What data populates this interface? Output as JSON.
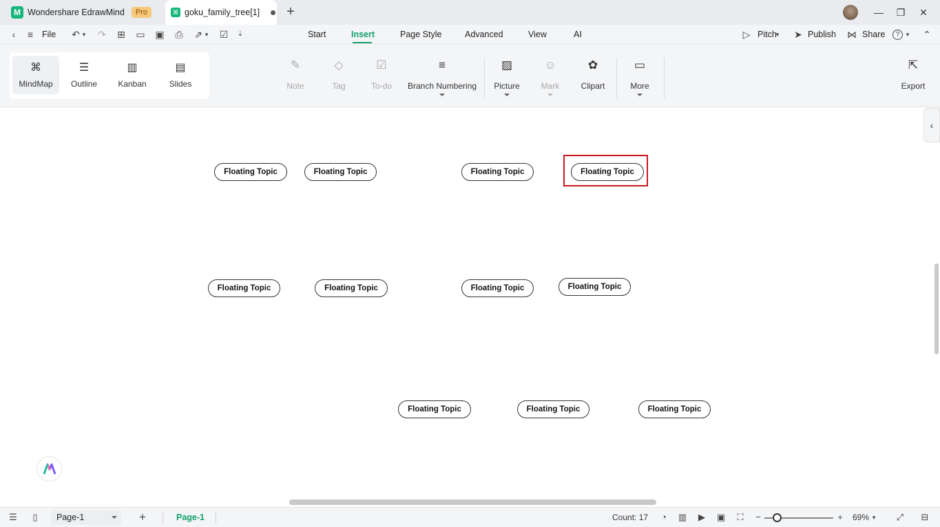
{
  "titlebar": {
    "app_tab": {
      "logo_text": "M",
      "title": "Wondershare EdrawMind",
      "badge": "Pro"
    },
    "doc_tab": {
      "title": "goku_family_tree[1]"
    },
    "new_tab": "+",
    "window_controls": {
      "minimize": "—",
      "maximize": "❐",
      "close": "✕"
    }
  },
  "menubar": {
    "file_label": "File",
    "tabs": [
      {
        "label": "Start"
      },
      {
        "label": "Insert",
        "active": true
      },
      {
        "label": "Page Style"
      },
      {
        "label": "Advanced"
      },
      {
        "label": "View"
      },
      {
        "label": "AI"
      }
    ],
    "pitch_label": "Pitch",
    "publish_label": "Publish",
    "share_label": "Share",
    "help_label": "?"
  },
  "views": [
    {
      "label": "MindMap",
      "icon": "mindmap-icon",
      "glyph": "⌘",
      "active": true
    },
    {
      "label": "Outline",
      "icon": "outline-icon",
      "glyph": "☰"
    },
    {
      "label": "Kanban",
      "icon": "kanban-icon",
      "glyph": "▥"
    },
    {
      "label": "Slides",
      "icon": "slides-icon",
      "glyph": "▤"
    }
  ],
  "tools": [
    {
      "label": "Note",
      "icon": "note-icon",
      "glyph": "✎",
      "enabled": false
    },
    {
      "label": "Tag",
      "icon": "tag-icon",
      "glyph": "◇",
      "enabled": false
    },
    {
      "label": "To-do",
      "icon": "todo-icon",
      "glyph": "☑",
      "enabled": false
    },
    {
      "label": "Branch Numbering",
      "icon": "branch-numbering-icon",
      "glyph": "≡",
      "enabled": true,
      "dropdown": true
    },
    {
      "label": "Picture",
      "icon": "picture-icon",
      "glyph": "▨",
      "enabled": true,
      "dropdown": true
    },
    {
      "label": "Mark",
      "icon": "mark-icon",
      "glyph": "☺",
      "enabled": false,
      "dropdown": true
    },
    {
      "label": "Clipart",
      "icon": "clipart-icon",
      "glyph": "✿",
      "enabled": true
    },
    {
      "label": "More",
      "icon": "more-icon",
      "glyph": "▭",
      "enabled": true,
      "dropdown": true
    },
    {
      "label": "Export",
      "icon": "export-icon",
      "glyph": "⇱",
      "enabled": true
    }
  ],
  "canvas": {
    "topics": [
      "Floating Topic",
      "Floating Topic",
      "Floating Topic",
      "Floating Topic",
      "Floating Topic",
      "Floating Topic",
      "Floating Topic",
      "Floating Topic",
      "Floating Topic",
      "Floating Topic",
      "Floating Topic"
    ],
    "selected_topic_index": 3,
    "selection_color": "#c8171e"
  },
  "statusbar": {
    "page_select": "Page-1",
    "page_tab": "Page-1",
    "count": "Count: 17",
    "zoom": "69%",
    "zoom_level_percent": 69
  },
  "colors": {
    "accent": "#14a06b",
    "brand": "#14b67a"
  }
}
